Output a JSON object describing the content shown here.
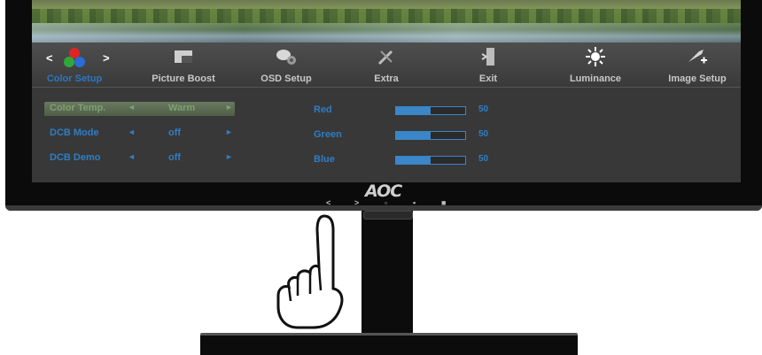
{
  "brand": "AOC",
  "menu": {
    "nav_left": "<",
    "nav_right": ">",
    "items": [
      {
        "label": "Color Setup",
        "icon": "color-setup-icon",
        "active": true
      },
      {
        "label": "Picture Boost",
        "icon": "picture-boost-icon",
        "active": false
      },
      {
        "label": "OSD Setup",
        "icon": "osd-setup-icon",
        "active": false
      },
      {
        "label": "Extra",
        "icon": "extra-tools-icon",
        "active": false
      },
      {
        "label": "Exit",
        "icon": "exit-door-icon",
        "active": false
      },
      {
        "label": "Luminance",
        "icon": "luminance-sun-icon",
        "active": false
      },
      {
        "label": "Image Setup",
        "icon": "image-setup-icon",
        "active": false
      }
    ]
  },
  "settings": [
    {
      "name": "Color Temp.",
      "value": "Warm",
      "left": "◄",
      "right": "►",
      "selected": true
    },
    {
      "name": "DCB Mode",
      "value": "off",
      "left": "◄",
      "right": "►",
      "selected": false
    },
    {
      "name": "DCB Demo",
      "value": "off",
      "left": "◄",
      "right": "►",
      "selected": false
    }
  ],
  "colors": [
    {
      "name": "Red",
      "value": "50",
      "level": 0.5
    },
    {
      "name": "Green",
      "value": "50",
      "level": 0.5
    },
    {
      "name": "Blue",
      "value": "50",
      "level": 0.5
    }
  ],
  "keys": [
    "<",
    ">",
    "▫",
    "▪",
    "■"
  ],
  "accent_color": "#2e7ec4"
}
